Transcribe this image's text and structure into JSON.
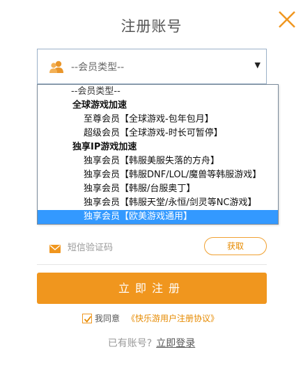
{
  "title": "注册账号",
  "colors": {
    "accent": "#f0961e",
    "selected": "#3399ff",
    "border": "#9ab0c8"
  },
  "icons": {
    "close": "close-icon",
    "user": "user-group-icon",
    "sms": "mail-icon",
    "caret": "caret-down-icon",
    "check": "check-icon"
  },
  "member_select": {
    "value": "--会员类型--",
    "caret": "▼",
    "options": [
      {
        "label": "--会员类型--",
        "kind": "placeholder"
      },
      {
        "label": "全球游戏加速",
        "kind": "group"
      },
      {
        "label": "至尊会员【全球游戏-包年包月】",
        "kind": "item"
      },
      {
        "label": "超级会员【全球游戏-时长可暂停】",
        "kind": "item"
      },
      {
        "label": "独享IP游戏加速",
        "kind": "group"
      },
      {
        "label": "独享会员【韩服美服失落的方舟】",
        "kind": "item"
      },
      {
        "label": "独享会员【韩服DNF/LOL/魔兽等韩服游戏】",
        "kind": "item"
      },
      {
        "label": "独享会员【韩服/台服奥丁】",
        "kind": "item"
      },
      {
        "label": "独享会员【韩服天堂/永恒/剑灵等NC游戏】",
        "kind": "item"
      },
      {
        "label": "独享会员【欧美游戏通用】",
        "kind": "item",
        "selected": true
      }
    ]
  },
  "sms": {
    "placeholder": "短信验证码",
    "get_label": "获取"
  },
  "submit_label": "立即注册",
  "agreement": {
    "prefix": "我同意",
    "link": "《快乐游用户注册协议》",
    "checked": true
  },
  "login": {
    "prompt": "已有账号?",
    "link": "立即登录"
  }
}
